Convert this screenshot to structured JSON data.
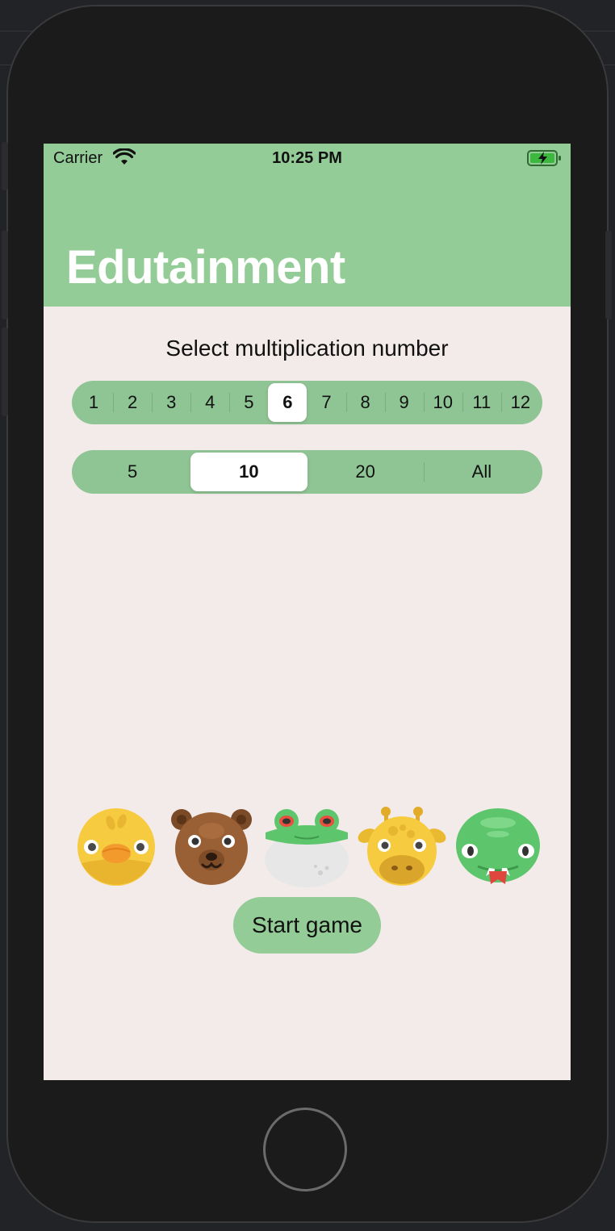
{
  "status_bar": {
    "carrier": "Carrier",
    "time": "10:25 PM"
  },
  "navigation": {
    "title": "Edutainment"
  },
  "main": {
    "prompt": "Select multiplication number",
    "multiplication_picker": {
      "options": [
        "1",
        "2",
        "3",
        "4",
        "5",
        "6",
        "7",
        "8",
        "9",
        "10",
        "11",
        "12"
      ],
      "selected": "6"
    },
    "question_count_picker": {
      "options": [
        "5",
        "10",
        "20",
        "All"
      ],
      "selected": "10"
    },
    "animals": [
      "duck-icon",
      "bear-icon",
      "frog-icon",
      "giraffe-icon",
      "crocodile-icon"
    ],
    "start_button": "Start game"
  },
  "colors": {
    "accent": "#93cc96",
    "segment_bg": "#8fc494",
    "background": "#f3ebe9"
  }
}
